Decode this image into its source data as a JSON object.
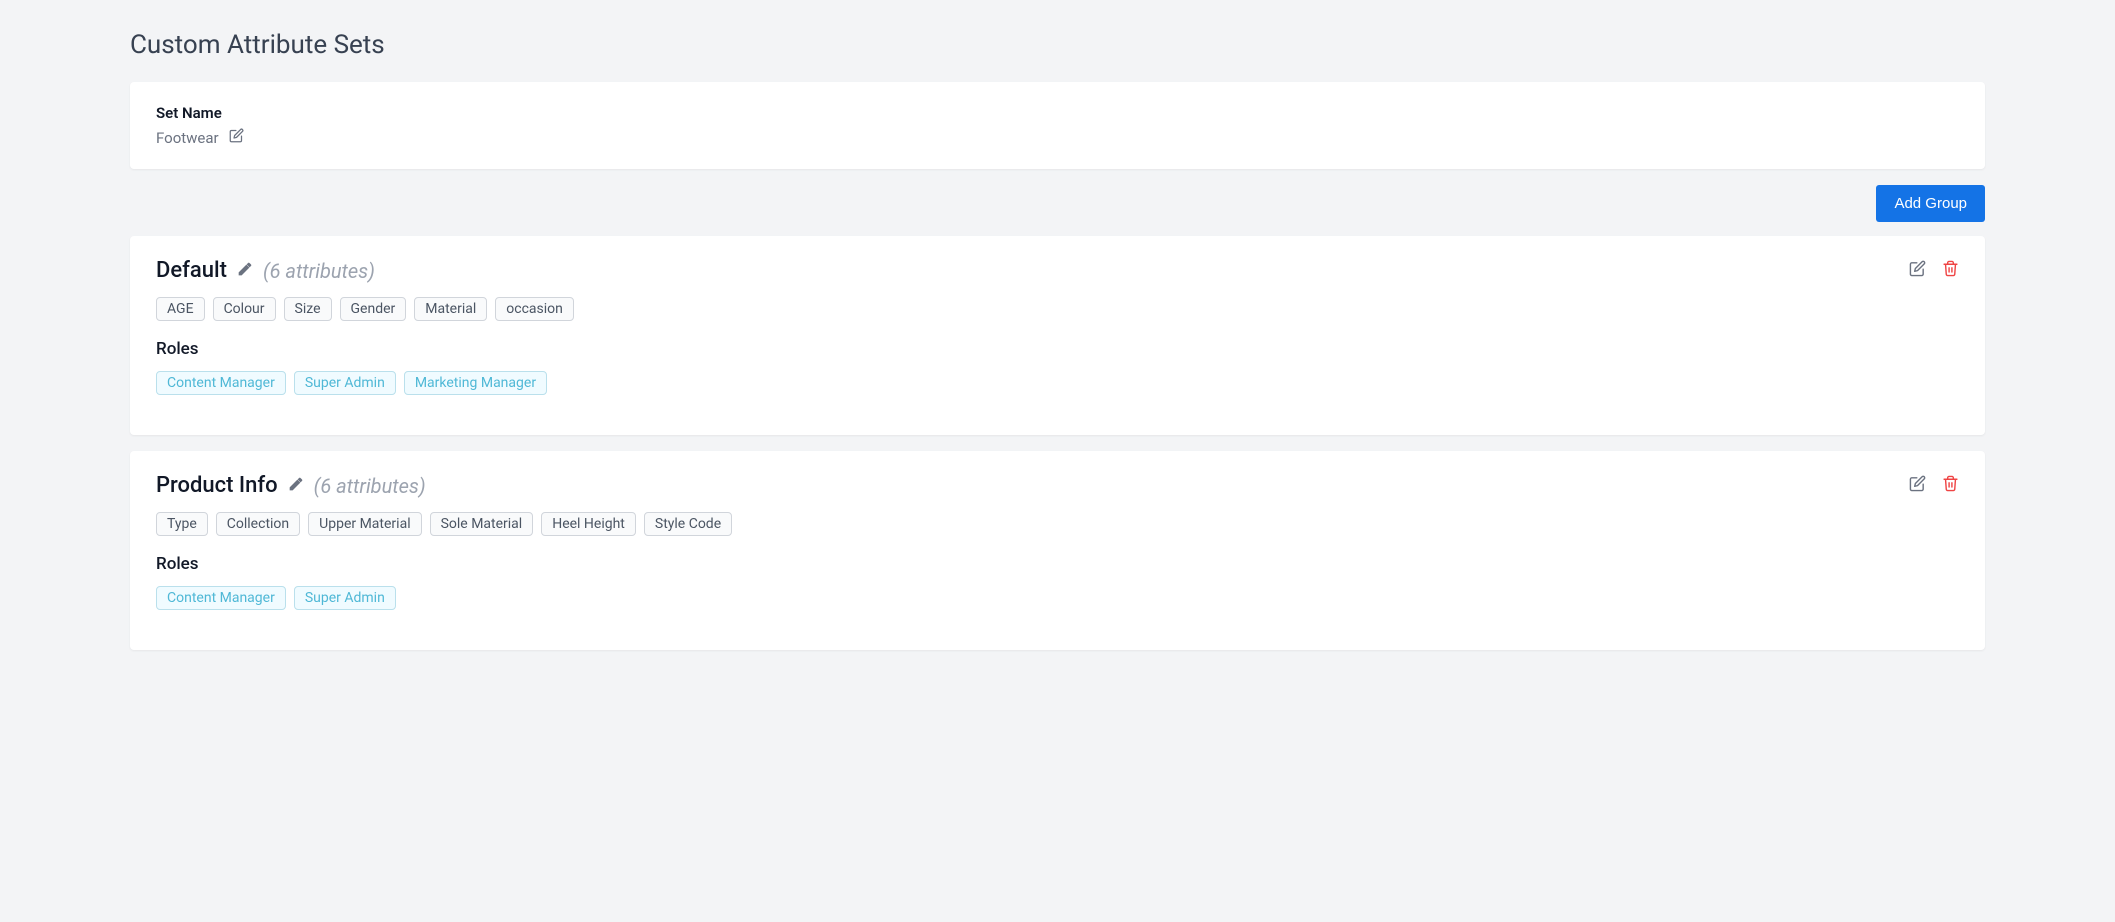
{
  "page": {
    "title": "Custom Attribute Sets"
  },
  "set": {
    "name_label": "Set Name",
    "name_value": "Footwear"
  },
  "actions": {
    "add_group_label": "Add Group"
  },
  "roles_label": "Roles",
  "groups": [
    {
      "title": "Default",
      "count_text": "(6 attributes)",
      "attributes": [
        "AGE",
        "Colour",
        "Size",
        "Gender",
        "Material",
        "occasion"
      ],
      "roles": [
        "Content Manager",
        "Super Admin",
        "Marketing Manager"
      ]
    },
    {
      "title": "Product Info",
      "count_text": "(6 attributes)",
      "attributes": [
        "Type",
        "Collection",
        "Upper Material",
        "Sole Material",
        "Heel Height",
        "Style Code"
      ],
      "roles": [
        "Content Manager",
        "Super Admin"
      ]
    }
  ]
}
